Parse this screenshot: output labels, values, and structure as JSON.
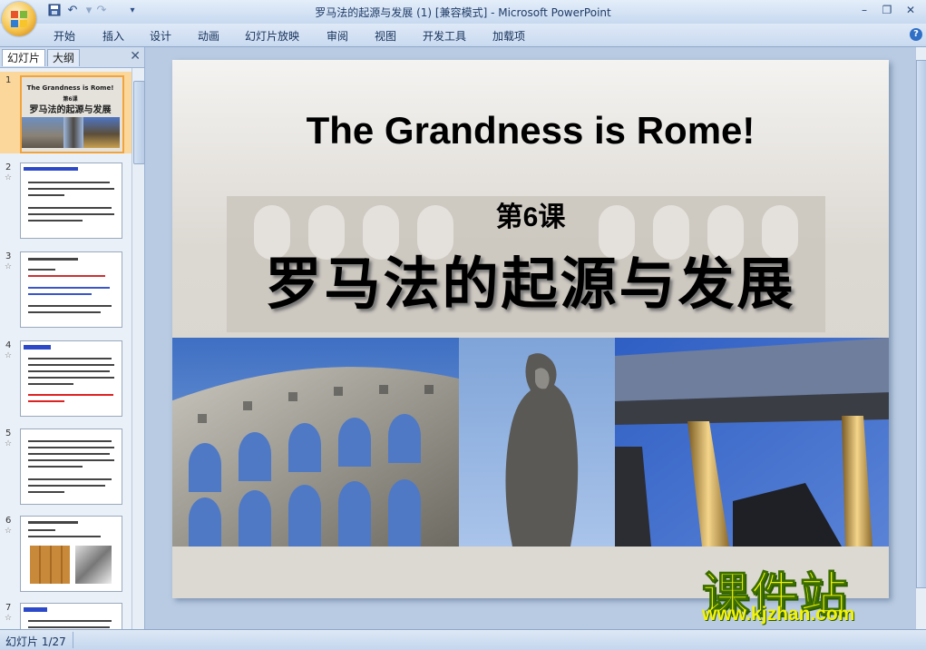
{
  "window": {
    "title": "罗马法的起源与发展 (1) [兼容模式] - Microsoft PowerPoint",
    "controls": [
      "minimize-icon",
      "restore-icon",
      "close-icon"
    ]
  },
  "quick_access": [
    "save-icon",
    "undo-icon",
    "redo-icon",
    "customize-dropdown-icon"
  ],
  "ribbon": {
    "tabs": [
      "开始",
      "插入",
      "设计",
      "动画",
      "幻灯片放映",
      "审阅",
      "视图",
      "开发工具",
      "加载项"
    ]
  },
  "left_panel": {
    "tabs": [
      "幻灯片",
      "大纲"
    ],
    "slides": [
      {
        "number": "1",
        "title": "The Grandness is Rome!",
        "subtitle": "第6课",
        "heading": "罗马法的起源与发展",
        "selected": true
      },
      {
        "number": "2",
        "has_animation": true
      },
      {
        "number": "3",
        "has_animation": true
      },
      {
        "number": "4",
        "has_animation": true
      },
      {
        "number": "5",
        "has_animation": true
      },
      {
        "number": "6",
        "has_animation": true
      },
      {
        "number": "7",
        "has_animation": true
      }
    ],
    "star_glyph": "☆"
  },
  "slide": {
    "title": "The Grandness is Rome!",
    "lesson": "第6课",
    "heading": "罗马法的起源与发展",
    "images": [
      "colosseum-photo",
      "statue-photo",
      "ruins-column-photo"
    ]
  },
  "watermark": {
    "cn": "课件站",
    "url": "www.kjzhan.com"
  },
  "status": {
    "slide_info": "幻灯片 1/27"
  },
  "colors": {
    "ribbon_bg": "#c9daf0",
    "selection": "#f2a33a",
    "watermark": "#f3f20a"
  }
}
